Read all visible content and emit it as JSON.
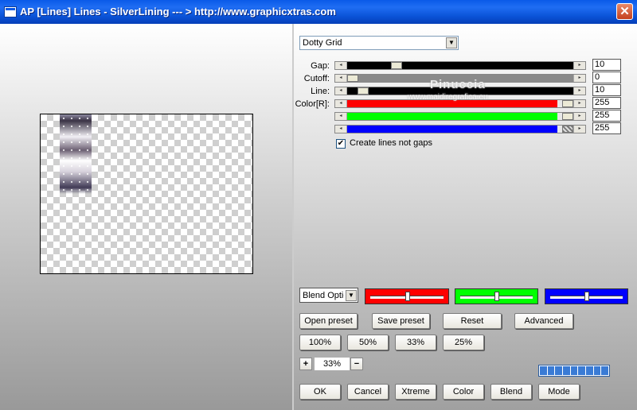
{
  "window": {
    "title": "AP [Lines]  Lines - SilverLining     --- > http://www.graphicxtras.com",
    "close_glyph": "✕"
  },
  "filter_select": {
    "value": "Dotty Grid"
  },
  "sliders": {
    "gap": {
      "label": "Gap:",
      "value": "10"
    },
    "cutoff": {
      "label": "Cutoff:",
      "value": "0"
    },
    "line": {
      "label": "Line:",
      "value": "10"
    },
    "red": {
      "label": "Color[R]:",
      "value": "255"
    },
    "green": {
      "value": "255"
    },
    "blue": {
      "value": "255"
    }
  },
  "checkbox": {
    "label": "Create lines not gaps",
    "checked": true
  },
  "watermark": {
    "name": "Pinuccia",
    "url": "www.maidiregrafica.eu"
  },
  "blend": {
    "value": "Blend Options"
  },
  "buttons": {
    "open_preset": "Open preset",
    "save_preset": "Save preset",
    "reset": "Reset",
    "advanced": "Advanced",
    "z100": "100%",
    "z50": "50%",
    "z33": "33%",
    "z25": "25%",
    "plus": "+",
    "minus": "−",
    "ok": "OK",
    "cancel": "Cancel",
    "xtreme": "Xtreme",
    "color": "Color",
    "blend": "Blend",
    "mode": "Mode"
  },
  "zoom": {
    "value": "33%"
  },
  "colors": {
    "red": "#ff0000",
    "green": "#00ff00",
    "blue": "#0000ff",
    "title_bar": "#0a5ae8"
  }
}
